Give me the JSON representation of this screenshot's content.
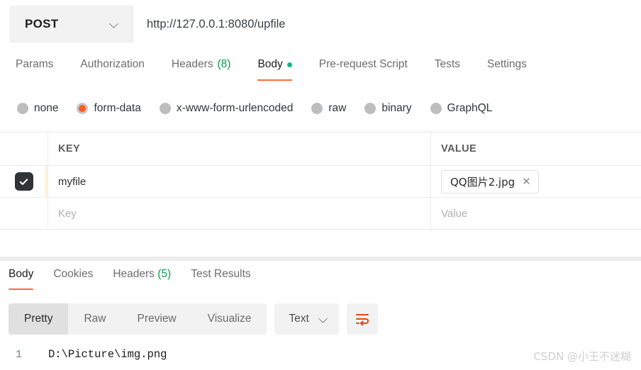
{
  "request": {
    "method": "POST",
    "url": "http://127.0.0.1:8080/upfile",
    "method_chevron_icon": "chevron-down-icon",
    "tabs": [
      {
        "label": "Params",
        "count": "",
        "active": false,
        "dot": false
      },
      {
        "label": "Authorization",
        "count": "",
        "active": false,
        "dot": false
      },
      {
        "label": "Headers",
        "count": "(8)",
        "active": false,
        "dot": false
      },
      {
        "label": "Body",
        "count": "",
        "active": true,
        "dot": true
      },
      {
        "label": "Pre-request Script",
        "count": "",
        "active": false,
        "dot": false
      },
      {
        "label": "Tests",
        "count": "",
        "active": false,
        "dot": false
      },
      {
        "label": "Settings",
        "count": "",
        "active": false,
        "dot": false
      }
    ],
    "body_types": [
      {
        "label": "none",
        "selected": false
      },
      {
        "label": "form-data",
        "selected": true
      },
      {
        "label": "x-www-form-urlencoded",
        "selected": false
      },
      {
        "label": "raw",
        "selected": false
      },
      {
        "label": "binary",
        "selected": false
      },
      {
        "label": "GraphQL",
        "selected": false
      }
    ],
    "table": {
      "headers": {
        "key": "KEY",
        "value": "VALUE"
      },
      "rows": [
        {
          "checked": true,
          "key": "myfile",
          "value_file": "QQ图片2.jpg",
          "remove_label": "✕",
          "placeholder_row": false
        },
        {
          "checked": false,
          "key_placeholder": "Key",
          "value_placeholder": "Value",
          "placeholder_row": true
        }
      ]
    }
  },
  "response": {
    "tabs": [
      {
        "label": "Body",
        "count": "",
        "active": true
      },
      {
        "label": "Cookies",
        "count": "",
        "active": false
      },
      {
        "label": "Headers",
        "count": "(5)",
        "active": false
      },
      {
        "label": "Test Results",
        "count": "",
        "active": false
      }
    ],
    "view_modes": [
      {
        "label": "Pretty",
        "active": true
      },
      {
        "label": "Raw",
        "active": false
      },
      {
        "label": "Preview",
        "active": false
      },
      {
        "label": "Visualize",
        "active": false
      }
    ],
    "format": {
      "label": "Text",
      "chevron_icon": "chevron-down-icon"
    },
    "wrap_button_icon": "wrap-text-icon",
    "body_lines": [
      {
        "number": "1",
        "text": "D:\\Picture\\img.png"
      }
    ]
  },
  "watermark": {
    "text": "CSDN @小王不迷糊"
  },
  "colors": {
    "accent": "#ff6c37",
    "radio_selected": "#ff5b1f",
    "count_green": "#0c9b4b",
    "dot_green": "#10b981",
    "toolbar_bg": "#f2f2f2"
  }
}
